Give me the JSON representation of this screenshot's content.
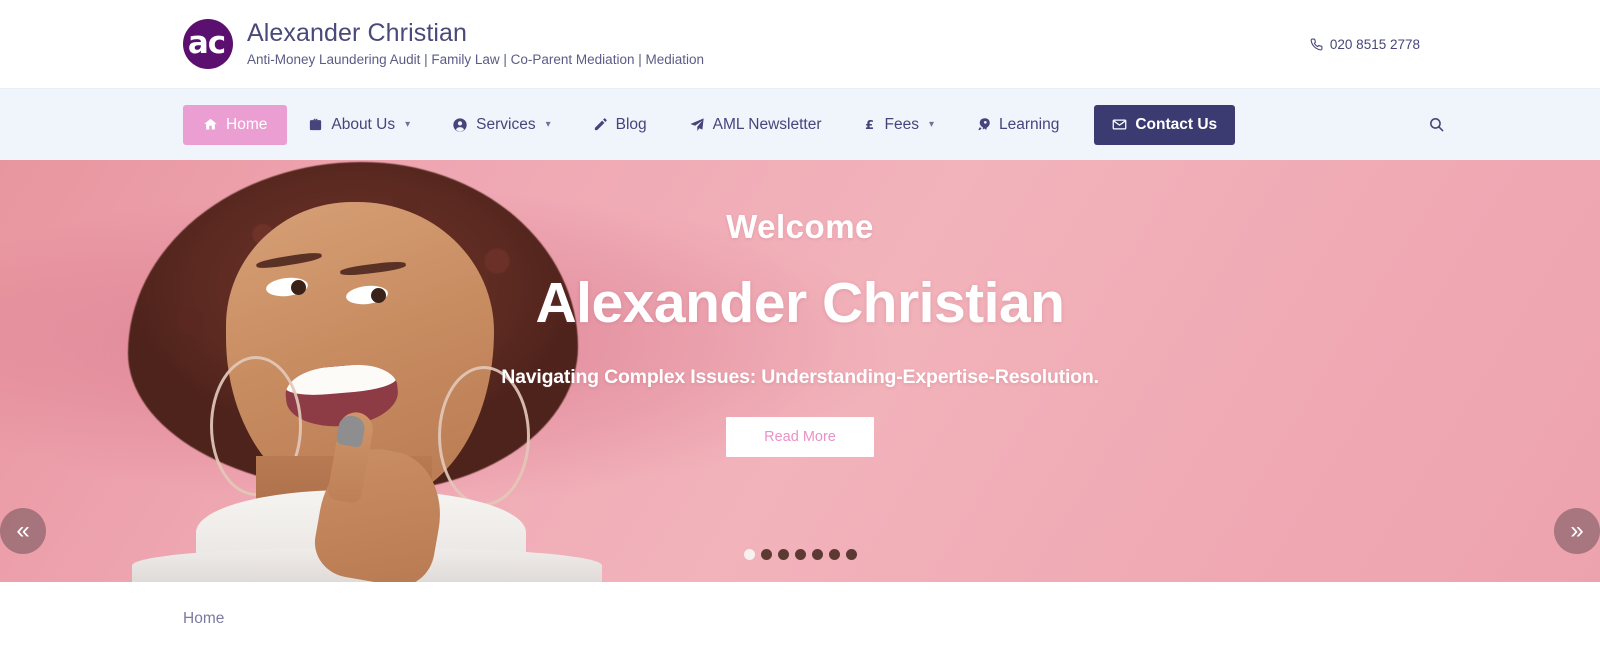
{
  "header": {
    "logo_text": "ac",
    "logo_icon": "circle-monogram-logo",
    "brand_title": "Alexander Christian",
    "brand_tagline": "Anti-Money Laundering Audit | Family Law | Co-Parent Mediation | Mediation",
    "phone_icon": "phone-icon",
    "phone": "020 8515 2778",
    "colors": {
      "logo_purple": "#5b0f6e",
      "brand_text": "#4a4a7a"
    }
  },
  "nav": {
    "background": "#f0f5fc",
    "active_color": "#eb9ed2",
    "cta_color": "#3b3b72",
    "search_icon": "search-icon",
    "items": [
      {
        "label": "Home",
        "icon": "home-icon",
        "caret": false,
        "state": "active"
      },
      {
        "label": "About Us",
        "icon": "briefcase-icon",
        "caret": true,
        "state": "default"
      },
      {
        "label": "Services",
        "icon": "user-circle-icon",
        "caret": true,
        "state": "default"
      },
      {
        "label": "Blog",
        "icon": "pencil-icon",
        "caret": false,
        "state": "default"
      },
      {
        "label": "AML Newsletter",
        "icon": "paper-plane-icon",
        "caret": false,
        "state": "default"
      },
      {
        "label": "Fees",
        "icon": "pound-icon",
        "caret": true,
        "state": "default"
      },
      {
        "label": "Learning",
        "icon": "rocket-icon",
        "caret": false,
        "state": "default"
      },
      {
        "label": "Contact Us",
        "icon": "envelope-icon",
        "caret": false,
        "state": "cta"
      }
    ]
  },
  "hero": {
    "welcome": "Welcome",
    "title": "Alexander Christian",
    "subtitle": "Navigating Complex Issues: Understanding-Expertise-Resolution.",
    "button_label": "Read More",
    "prev_icon": "chevron-double-left-icon",
    "next_icon": "chevron-double-right-icon",
    "prev_glyph": "«",
    "next_glyph": "»",
    "slide_count": 7,
    "active_slide": 1,
    "background_color": "#efa8b3"
  },
  "breadcrumb": {
    "home_label": "Home"
  }
}
